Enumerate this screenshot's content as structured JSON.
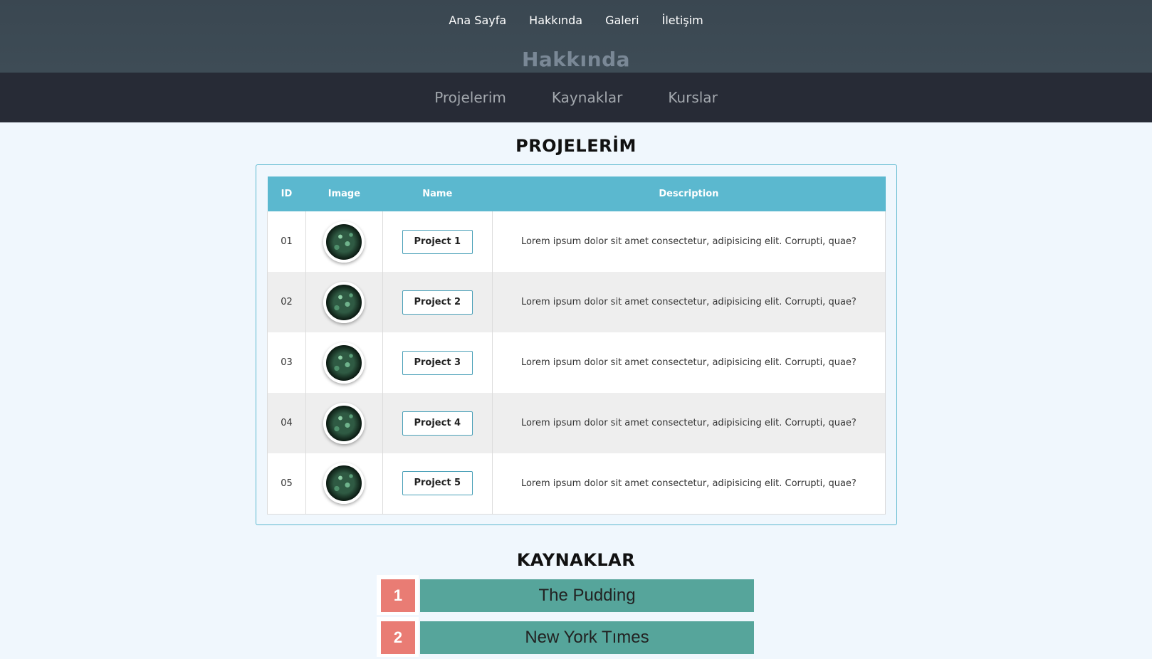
{
  "topnav": {
    "items": [
      {
        "label": "Ana Sayfa"
      },
      {
        "label": "Hakkında"
      },
      {
        "label": "Galeri"
      },
      {
        "label": "İletişim"
      }
    ]
  },
  "hero": {
    "title": "Hakkında"
  },
  "subnav": {
    "items": [
      {
        "label": "Projelerim"
      },
      {
        "label": "Kaynaklar"
      },
      {
        "label": "Kurslar"
      }
    ]
  },
  "projects": {
    "title": "PROJELERİM",
    "columns": [
      "ID",
      "Image",
      "Name",
      "Description"
    ],
    "rows": [
      {
        "id": "01",
        "name": "Project 1",
        "description": "Lorem ipsum dolor sit amet consectetur, adipisicing elit. Corrupti, quae?"
      },
      {
        "id": "02",
        "name": "Project 2",
        "description": "Lorem ipsum dolor sit amet consectetur, adipisicing elit. Corrupti, quae?"
      },
      {
        "id": "03",
        "name": "Project 3",
        "description": "Lorem ipsum dolor sit amet consectetur, adipisicing elit. Corrupti, quae?"
      },
      {
        "id": "04",
        "name": "Project 4",
        "description": "Lorem ipsum dolor sit amet consectetur, adipisicing elit. Corrupti, quae?"
      },
      {
        "id": "05",
        "name": "Project 5",
        "description": "Lorem ipsum dolor sit amet consectetur, adipisicing elit. Corrupti, quae?"
      }
    ]
  },
  "resources": {
    "title": "KAYNAKLAR",
    "items": [
      {
        "number": "1",
        "label": "The Pudding"
      },
      {
        "number": "2",
        "label": "New York Tımes"
      }
    ]
  },
  "colors": {
    "topbar": "#3e4c56",
    "subbar": "#272b36",
    "table_header": "#5bb8cf",
    "resource_number": "#e97c74",
    "resource_bar": "#56a59b",
    "page_background": "#f0f7fd"
  }
}
